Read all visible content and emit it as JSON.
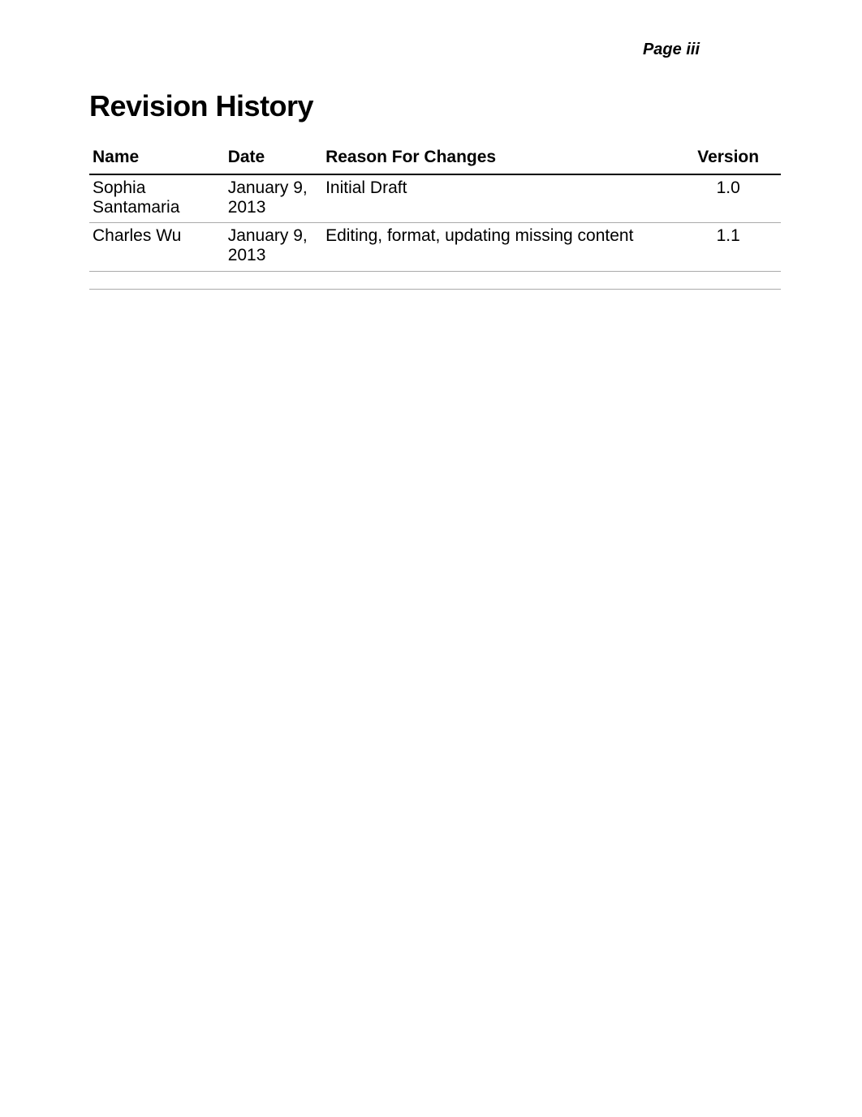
{
  "page_number": "Page iii",
  "title": "Revision History",
  "table": {
    "headers": {
      "name": "Name",
      "date": "Date",
      "reason": "Reason For Changes",
      "version": "Version"
    },
    "rows": [
      {
        "name": "Sophia Santamaria",
        "date": "January 9, 2013",
        "reason": "Initial Draft",
        "version": "1.0"
      },
      {
        "name": "Charles Wu",
        "date": "January 9, 2013",
        "reason": "Editing, format, updating missing content",
        "version": "1.1"
      }
    ]
  }
}
